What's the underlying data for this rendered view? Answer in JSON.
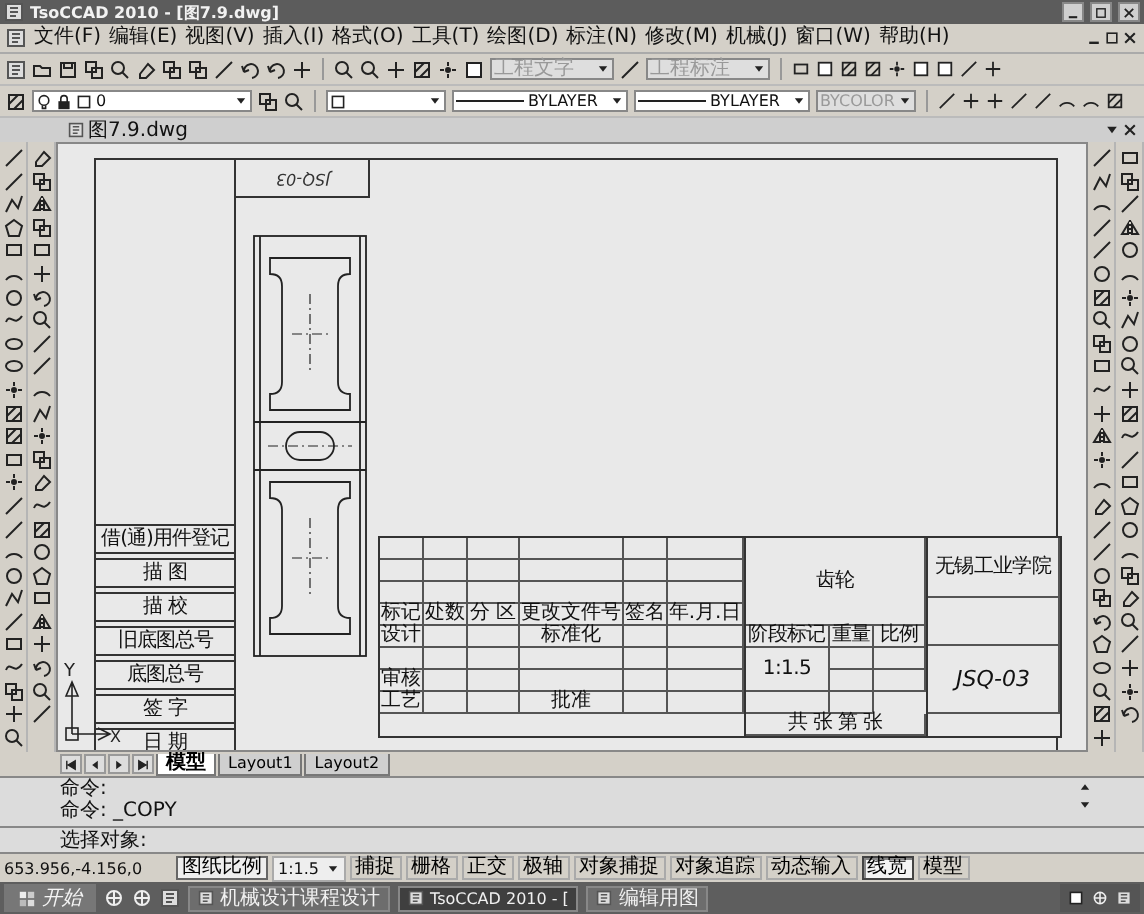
{
  "window": {
    "title": "TsoCCAD 2010 - [图7.9.dwg]"
  },
  "menu": [
    "文件(F)",
    "编辑(E)",
    "视图(V)",
    "插入(I)",
    "格式(O)",
    "工具(T)",
    "绘图(D)",
    "标注(N)",
    "修改(M)",
    "机械(J)",
    "窗口(W)",
    "帮助(H)"
  ],
  "toolbar": {
    "text_style": {
      "value": "工程文字",
      "disabled": true
    },
    "dim_style": {
      "value": "工程标注",
      "disabled": true
    }
  },
  "properties_bar": {
    "layer": "0",
    "linetype": "BYLAYER",
    "lineweight": "BYLAYER",
    "plot_style": {
      "value": "BYCOLOR",
      "disabled": true
    }
  },
  "document_tab": {
    "title": "图7.9.dwg"
  },
  "drawing": {
    "rotated_number": "JSQ-03",
    "side_labels": [
      "借(通)用件登记",
      "描 图",
      "描 校",
      "旧底图总号",
      "底图总号",
      "签 字",
      "日 期"
    ],
    "title_block": {
      "revision_headers": [
        "标记",
        "处数",
        "分 区",
        "更改文件号",
        "签名",
        "年.月.日"
      ],
      "design_label": "设计",
      "standard_label": "标准化",
      "review_label": "审核",
      "process_label": "工艺",
      "approve_label": "批准",
      "part_name": "齿轮",
      "stage_headers": [
        "阶段标记",
        "重量",
        "比例"
      ],
      "scale": "1:1.5",
      "sheet": "共 张 第 张",
      "company": "无锡工业学院",
      "drawing_number": "JSQ-03"
    },
    "ucs": {
      "x_label": "X",
      "y_label": "Y"
    }
  },
  "layout_tabs": [
    {
      "label": "模型",
      "selected": true
    },
    {
      "label": "Layout1",
      "selected": false
    },
    {
      "label": "Layout2",
      "selected": false
    }
  ],
  "command_history": [
    "命令:",
    "命令: _COPY"
  ],
  "command_prompt": "选择对象:",
  "status_bar": {
    "coordinates": "653.956,-4.156,0",
    "scale_label": "图纸比例",
    "scale": "1:1.5",
    "toggles": [
      {
        "label": "捕捉",
        "on": false
      },
      {
        "label": "栅格",
        "on": false
      },
      {
        "label": "正交",
        "on": false
      },
      {
        "label": "极轴",
        "on": false
      },
      {
        "label": "对象捕捉",
        "on": false
      },
      {
        "label": "对象追踪",
        "on": false
      },
      {
        "label": "动态输入",
        "on": false
      },
      {
        "label": "线宽",
        "on": true
      },
      {
        "label": "模型",
        "on": false
      }
    ]
  },
  "taskbar": {
    "start": "开始",
    "items": [
      {
        "label": "机械设计课程设计",
        "selected": false
      },
      {
        "label": "TsoCCAD 2010 - [",
        "selected": true
      },
      {
        "label": "编辑用图",
        "selected": false
      }
    ]
  }
}
